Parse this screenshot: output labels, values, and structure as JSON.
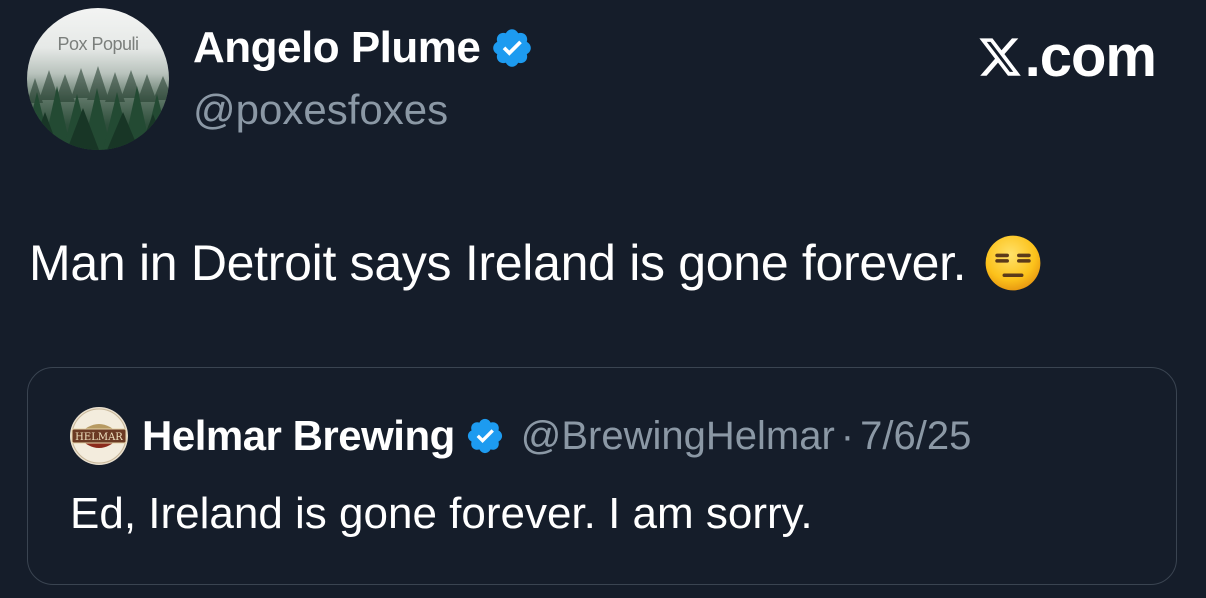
{
  "author": {
    "avatar_text": "Pox Populi",
    "display_name": "Angelo Plume",
    "handle": "@poxesfoxes",
    "verified_icon": "verified-badge-icon"
  },
  "brand": {
    "logo_icon": "x-logo-icon",
    "domain_suffix": ".com"
  },
  "tweet": {
    "text": "Man in Detroit says Ireland is gone forever.",
    "emoji_icon": "expressionless-face-emoji"
  },
  "quoted_tweet": {
    "avatar_text": "HELMAR",
    "display_name": "Helmar Brewing",
    "handle": "@BrewingHelmar",
    "separator": "·",
    "date": "7/6/25",
    "text": "Ed, Ireland is gone forever. I am sorry."
  },
  "colors": {
    "background": "#151d2a",
    "primary_text": "#ffffff",
    "secondary_text": "#8b98a5",
    "verified_blue": "#1d9bf0",
    "border": "#3a4451"
  }
}
